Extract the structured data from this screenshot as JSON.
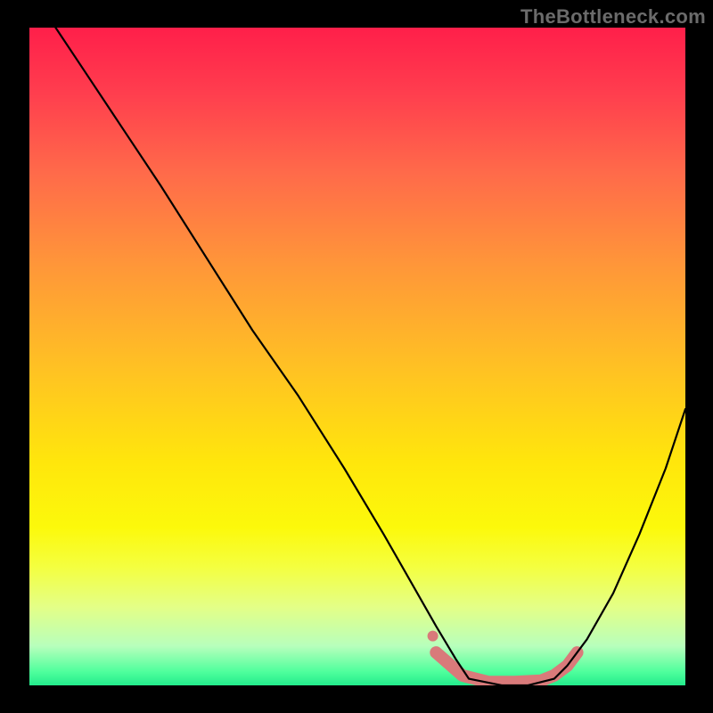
{
  "watermark": "TheBottleneck.com",
  "chart_data": {
    "type": "line",
    "title": "",
    "xlabel": "",
    "ylabel": "",
    "xlim": [
      0,
      100
    ],
    "ylim": [
      0,
      100
    ],
    "series": [
      {
        "name": "bottleneck-curve",
        "x": [
          4,
          8,
          14,
          20,
          27,
          34,
          41,
          48,
          54,
          58,
          62,
          65,
          67,
          72,
          76,
          80,
          82,
          85,
          89,
          93,
          97,
          100
        ],
        "y": [
          100,
          94,
          85,
          76,
          65,
          54,
          44,
          33,
          23,
          16,
          9,
          4,
          1,
          0,
          0,
          1,
          3,
          7,
          14,
          23,
          33,
          42
        ],
        "color": "#000000",
        "stroke_width": 2
      }
    ],
    "annotations": [
      {
        "name": "left-marker-dot",
        "type": "point",
        "x": 61.5,
        "y": 7.5,
        "color": "#d97a7a",
        "radius": 6
      },
      {
        "name": "valley-band",
        "type": "band",
        "points": [
          [
            62,
            5
          ],
          [
            66,
            1.5
          ],
          [
            70,
            0.5
          ],
          [
            74,
            0.5
          ],
          [
            78,
            0.7
          ],
          [
            80,
            1.5
          ],
          [
            82,
            3
          ],
          [
            83.5,
            5
          ]
        ],
        "color": "#d97a7a",
        "stroke_width": 14
      }
    ],
    "background_gradient": {
      "top": "#ff1f4a",
      "mid": "#ffe60c",
      "bottom": "#23eb8c"
    }
  }
}
